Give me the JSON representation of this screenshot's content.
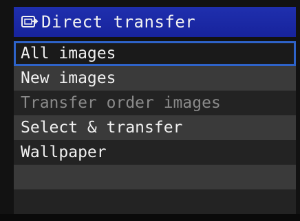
{
  "header": {
    "title": "Direct transfer",
    "icon": "transfer-icon"
  },
  "menu": {
    "items": [
      {
        "label": "All images",
        "state": "selected"
      },
      {
        "label": "New images",
        "state": "enabled"
      },
      {
        "label": "Transfer order images",
        "state": "disabled"
      },
      {
        "label": "Select & transfer",
        "state": "enabled"
      },
      {
        "label": "Wallpaper",
        "state": "enabled"
      }
    ]
  },
  "colors": {
    "title_bar": "#1f2fae",
    "selection_border": "#2e63c9",
    "text": "#f0f0f0",
    "disabled_text": "#8a8a8a"
  }
}
